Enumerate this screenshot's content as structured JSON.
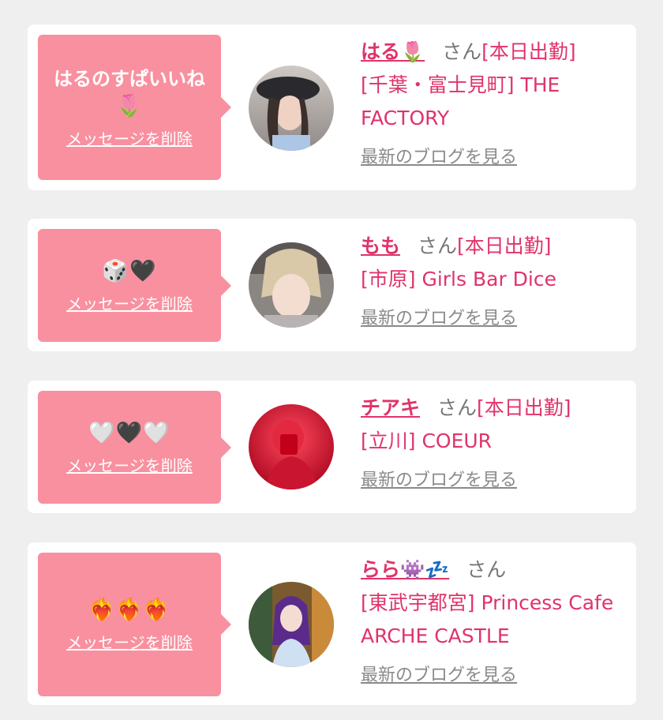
{
  "cards": [
    {
      "message_text": "はるのすぱいいね",
      "message_emoji": "🌷",
      "delete_label": "メッセージを削除",
      "name": "はる🌷",
      "san": "さん",
      "status": "[本日出勤]",
      "shop": "[千葉・富士見町] THE FACTORY",
      "blog_label": "最新のブログを見る"
    },
    {
      "message_text": "",
      "message_emoji": "🎲🖤",
      "delete_label": "メッセージを削除",
      "name": "もも",
      "san": "さん",
      "status": "[本日出勤]",
      "shop": "[市原] Girls Bar Dice",
      "blog_label": "最新のブログを見る"
    },
    {
      "message_text": "",
      "message_emoji": "🤍🖤🤍",
      "delete_label": "メッセージを削除",
      "name": "チアキ",
      "san": "さん",
      "status": "[本日出勤]",
      "shop": "[立川] COEUR",
      "blog_label": "最新のブログを見る"
    },
    {
      "message_text": "",
      "message_emoji": "❤️‍🔥❤️‍🔥❤️‍🔥",
      "delete_label": "メッセージを削除",
      "name": "らら👾💤",
      "san": "さん",
      "status": "",
      "shop": "[東武宇都宮] Princess Cafe ARCHE CASTLE",
      "blog_label": "最新のブログを見る"
    }
  ],
  "colors": {
    "accent": "#e0336a",
    "bubble": "#f9909f",
    "background": "#efefef",
    "card": "#ffffff",
    "muted": "#8a8a8a"
  }
}
